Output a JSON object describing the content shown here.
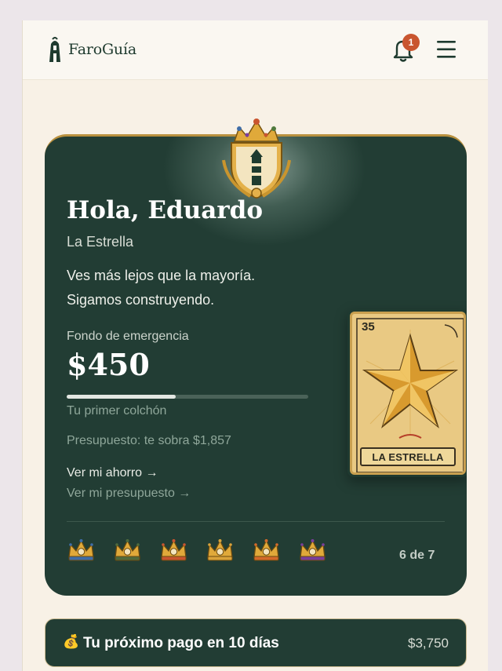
{
  "header": {
    "brand": "FaroGuía",
    "notification_count": "1",
    "logo_icon": "lighthouse-icon",
    "bell_icon": "bell-icon",
    "menu_icon": "hamburger-menu-icon"
  },
  "hero": {
    "greeting": "Hola, Eduardo",
    "subtitle": "La Estrella",
    "message": "Ves más lejos que la mayoría. Sigamos construyendo.",
    "fund_label": "Fondo de emergencia",
    "fund_amount": "$450",
    "progress_fraction": 0.45,
    "progress_caption": "Tu primer colchón",
    "budget_text": "Presupuesto: te sobra $1,857",
    "link_savings": "Ver mi ahorro →",
    "link_budget": "Ver mi presupuesto →",
    "crowns_count_label": "6 de 7",
    "crown_colors": [
      "#3f6da8",
      "#4f6a3c",
      "#c9552f",
      "#d9a23a",
      "#d46a2a",
      "#7a3e9c"
    ]
  },
  "loteria_card": {
    "number": "35",
    "label": "LA ESTRELLA"
  },
  "next_payment": {
    "icon": "money-bag-icon",
    "text": "Tu próximo pago en 10 días",
    "amount": "$3,750"
  },
  "colors": {
    "card_bg": "#223d34",
    "page_bg": "#f8f1e6",
    "accent": "#c9552f",
    "gold": "#d9a23a"
  }
}
